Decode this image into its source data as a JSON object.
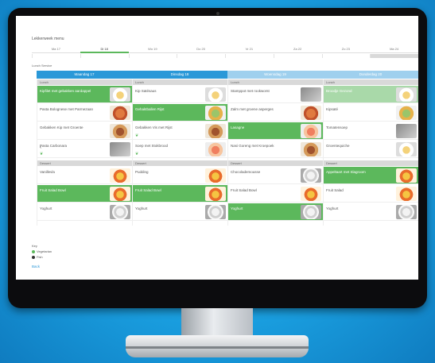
{
  "app": {
    "title": "Lekkerweek menu"
  },
  "day_nav": [
    "Ma 17",
    "Di 18",
    "Wo 19",
    "Do 20",
    "Vr 21",
    "Za 22",
    "Zo 23",
    "Ma 24"
  ],
  "active_day_index": 1,
  "section_label": "Lunch Service",
  "day_headers": [
    {
      "label": "Maandag 17",
      "style": "blue"
    },
    {
      "label": "Dinsdag 18",
      "style": "blue"
    },
    {
      "label": "Woensdag 19",
      "style": "lightblue"
    },
    {
      "label": "Donderdag 20",
      "style": "lightblue"
    }
  ],
  "columns": [
    {
      "lunch_label": "Lunch",
      "lunch": [
        {
          "name": "Kipfilet met gebakken aardappel",
          "state": "green",
          "thumb": "plate",
          "veg": false
        },
        {
          "name": "Pasta Bolognese met Parmezaan",
          "state": "none",
          "thumb": "pasta",
          "veg": false
        },
        {
          "name": "Gebakken Kip met Groente",
          "state": "none",
          "thumb": "meat",
          "veg": false
        },
        {
          "name": "Pasta Carbonara",
          "state": "none",
          "thumb": "grey",
          "veg": true
        }
      ],
      "dessert_label": "Dessert",
      "dessert": [
        {
          "name": "Vanillevla",
          "state": "none",
          "thumb": "dessert"
        },
        {
          "name": "Fruit Salad Bowl",
          "state": "green",
          "thumb": "dessert"
        },
        {
          "name": "Yoghurt",
          "state": "none",
          "thumb": "soup"
        }
      ]
    },
    {
      "lunch_label": "Lunch",
      "lunch": [
        {
          "name": "Kip Satésaus",
          "state": "none",
          "thumb": "plate",
          "veg": false
        },
        {
          "name": "Gehaktballen Rijst",
          "state": "green",
          "thumb": "salad",
          "veg": false
        },
        {
          "name": "Gebakken Vis met Rijst",
          "state": "none",
          "thumb": "meat",
          "veg": true
        },
        {
          "name": "Soep met Stokbrood",
          "state": "none",
          "thumb": "fish",
          "veg": true
        }
      ],
      "dessert_label": "Dessert",
      "dessert": [
        {
          "name": "Pudding",
          "state": "none",
          "thumb": "dessert"
        },
        {
          "name": "Fruit Salad Bowl",
          "state": "green",
          "thumb": "dessert"
        },
        {
          "name": "Yoghurt",
          "state": "none",
          "thumb": "soup"
        }
      ]
    },
    {
      "lunch_label": "Lunch",
      "lunch": [
        {
          "name": "Stamppot met rookworst",
          "state": "none",
          "thumb": "grey",
          "veg": false
        },
        {
          "name": "Zalm met groene asperges",
          "state": "none",
          "thumb": "pasta",
          "veg": false
        },
        {
          "name": "Lasagne",
          "state": "green",
          "thumb": "fish",
          "veg": false
        },
        {
          "name": "Nasi Goreng met Kroepoek",
          "state": "none",
          "thumb": "meat",
          "veg": false
        }
      ],
      "dessert_label": "Dessert",
      "dessert": [
        {
          "name": "Chocolademousse",
          "state": "none",
          "thumb": "soup"
        },
        {
          "name": "Fruit Salad Bowl",
          "state": "none",
          "thumb": "dessert"
        },
        {
          "name": "Yoghurt",
          "state": "green",
          "thumb": "soup"
        }
      ]
    },
    {
      "lunch_label": "Lunch",
      "lunch": [
        {
          "name": "Broodje Gezond",
          "state": "lightgreen",
          "thumb": "plate",
          "veg": false
        },
        {
          "name": "Kipsaté",
          "state": "none",
          "thumb": "salad",
          "veg": false
        },
        {
          "name": "Tomatensoep",
          "state": "none",
          "thumb": "grey",
          "veg": false
        },
        {
          "name": "Groentequiche",
          "state": "none",
          "thumb": "plate",
          "veg": false
        }
      ],
      "dessert_label": "Dessert",
      "dessert": [
        {
          "name": "Appeltaart met Slagroom",
          "state": "green",
          "thumb": "dessert"
        },
        {
          "name": "Fruit Salad",
          "state": "none",
          "thumb": "dessert"
        },
        {
          "name": "Yoghurt",
          "state": "none",
          "thumb": "soup"
        }
      ]
    }
  ],
  "legend": {
    "title": "Key",
    "items": [
      {
        "label": "Vegetarian",
        "color": "#5cb85c"
      },
      {
        "label": "Fish",
        "color": "#333333"
      }
    ]
  },
  "link_label": "Back",
  "colors": {
    "accent_green": "#5cb85c",
    "accent_blue": "#2a98d8",
    "desk_blue": "#1a9fe0"
  }
}
